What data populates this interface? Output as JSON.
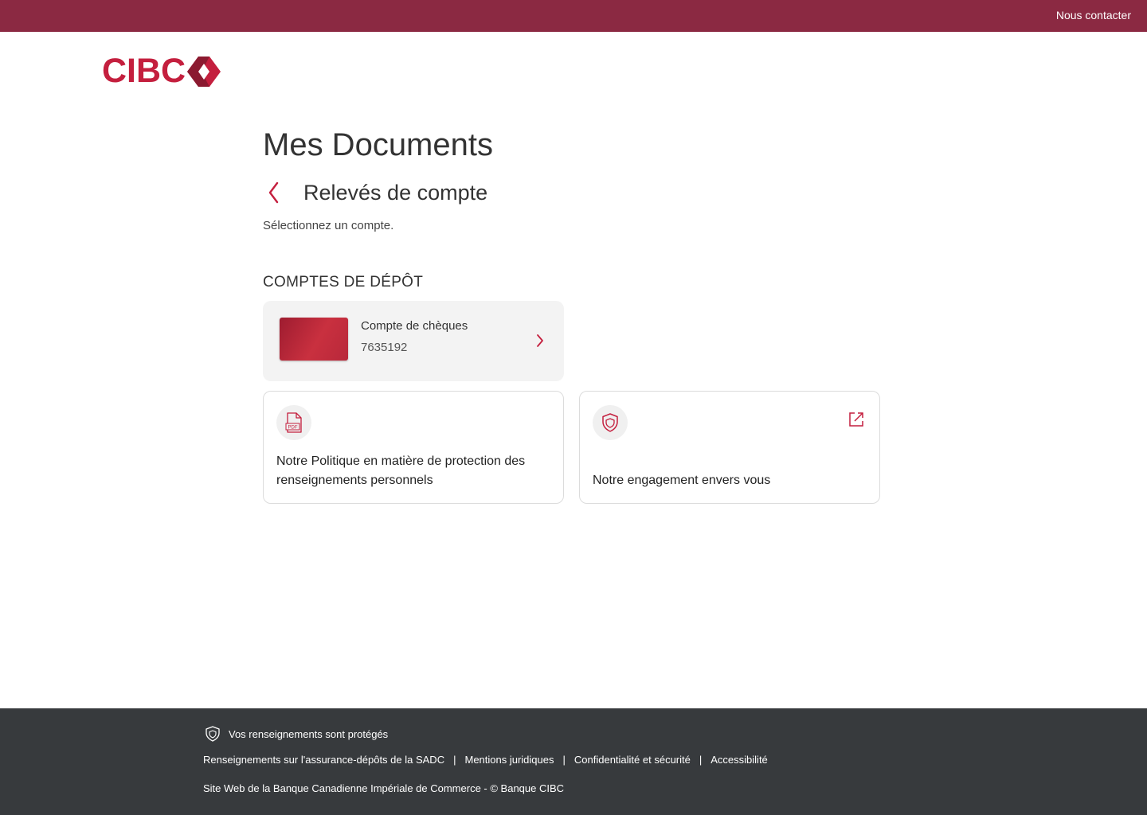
{
  "header": {
    "contact_link": "Nous contacter",
    "brand_color": "#8b2942"
  },
  "logo": {
    "text": "CIBC",
    "color": "#c41f3e"
  },
  "main": {
    "title": "Mes Documents",
    "subtitle": "Relevés de compte",
    "hint": "Sélectionnez un compte.",
    "back_icon": "chevron-left-icon"
  },
  "deposit_section": {
    "title": "COMPTES DE DÉPÔT",
    "accounts": [
      {
        "name": "Compte de chèques",
        "number": "7635192",
        "icon": "chevron-right-icon"
      }
    ]
  },
  "info_cards": [
    {
      "text": "Notre Politique en matière de protection des renseignements personnels",
      "icon": "pdf-icon"
    },
    {
      "text": "Notre engagement envers vous",
      "icon": "shield-icon",
      "action_icon": "external-link-icon"
    }
  ],
  "footer": {
    "secure_text": "Vos renseignements sont protégés",
    "links": [
      "Renseignements sur l'assurance-dépôts de la SADC",
      "Mentions juridiques",
      "Confidentialité et sécurité",
      "Accessibilité"
    ],
    "separator": "|",
    "copyright": "Site Web de la Banque Canadienne Impériale de Commerce - © Banque CIBC",
    "background": "#373a3d"
  },
  "accent_color": "#c41f3e"
}
